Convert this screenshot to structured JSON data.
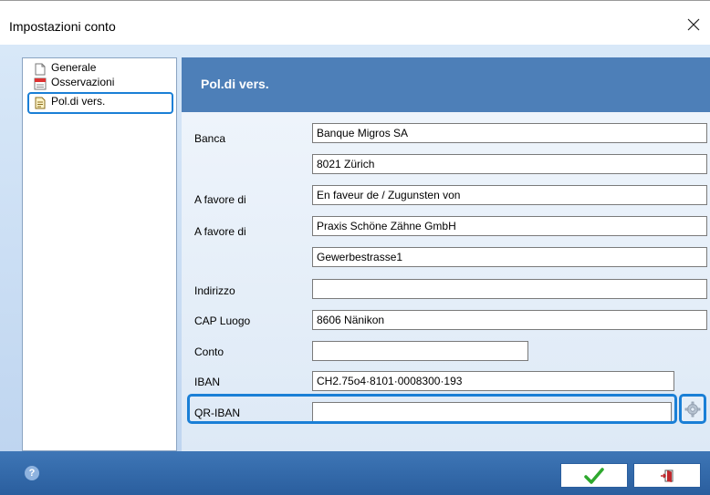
{
  "window": {
    "title": "Impostazioni conto"
  },
  "tree": {
    "items": [
      {
        "label": "Generale",
        "icon": "page-icon"
      },
      {
        "label": "Osservazioni",
        "icon": "notes-icon"
      },
      {
        "label": "Pol.di vers.",
        "icon": "payment-slip-icon"
      }
    ],
    "selected": "Pol.di vers."
  },
  "panel": {
    "title": "Pol.di vers."
  },
  "form": {
    "banca_label": "Banca",
    "banca_line1": "Banque Migros SA",
    "banca_line2": "8021 Zürich",
    "favore1_label": "A favore di",
    "favore1_value": "En faveur de / Zugunsten von",
    "favore2_label": "A favore di",
    "favore2_line1": "Praxis Schöne Zähne GmbH",
    "favore2_line2": "Gewerbestrasse1",
    "indirizzo_label": "Indirizzo",
    "indirizzo_value": "",
    "cap_label": "CAP Luogo",
    "cap_value": "8606 Nänikon",
    "conto_label": "Conto",
    "conto_value": "",
    "iban_label": "IBAN",
    "iban_value": "CH2.75o4·8101·0008300·193",
    "qriban_label": "QR-IBAN",
    "qriban_value": ""
  },
  "colors": {
    "accent": "#1a7fd6",
    "header": "#4d7fb8",
    "footer": "#2a5e9e",
    "ok_check": "#2ea82e",
    "exit_red": "#c0282d"
  }
}
